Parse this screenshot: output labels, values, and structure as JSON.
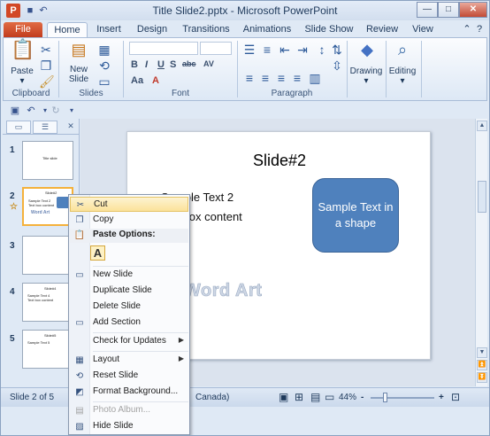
{
  "window": {
    "title": "Title Slide2.pptx - Microsoft PowerPoint",
    "app_icon_letter": "P",
    "controls": [
      "minimize-icon",
      "maximize-icon",
      "close-icon"
    ]
  },
  "ribbon": {
    "tabs": [
      "File",
      "Home",
      "Insert",
      "Design",
      "Transitions",
      "Animations",
      "Slide Show",
      "Review",
      "View"
    ],
    "active_tab": "Home",
    "groups": {
      "clipboard": {
        "label": "Clipboard",
        "paste_label": "Paste"
      },
      "slides": {
        "label": "Slides",
        "new_slide_label": "New Slide"
      },
      "font": {
        "label": "Font",
        "glyphs": [
          "B",
          "I",
          "U",
          "S",
          "abc",
          "AV",
          "Aa",
          "A"
        ]
      },
      "paragraph": {
        "label": "Paragraph"
      },
      "drawing": {
        "label": "Drawing"
      },
      "editing": {
        "label": "Editing"
      }
    }
  },
  "slide_pane": {
    "thumbnails": [
      {
        "num": "1",
        "title": "Title slide"
      },
      {
        "num": "2",
        "title": "Slide#2",
        "line1": "Sample Text 2",
        "line2": "Text box content",
        "wordart": "Word Art",
        "selected": true
      },
      {
        "num": "3"
      },
      {
        "num": "4",
        "title": "Slide#4",
        "line1": "Sample Text 4",
        "line2": "Text box content"
      },
      {
        "num": "5",
        "title": "Slide#5",
        "line1": "Sample Text 5"
      }
    ]
  },
  "slide": {
    "title": "Slide#2",
    "text_line1": "Sample Text 2",
    "text_line2": "text box content",
    "shape_text": "Sample Text in a shape",
    "wordart": "Word Art",
    "shape_color": "#4f81bd"
  },
  "context_menu": {
    "items": [
      {
        "label": "Cut",
        "icon": "scissors-icon",
        "highlighted": true
      },
      {
        "label": "Copy",
        "icon": "copy-icon"
      },
      {
        "label": "Paste Options:",
        "icon": "paste-icon",
        "header": true
      },
      {
        "label": "A",
        "icon": "keep-text-only-icon"
      },
      {
        "label": "New Slide",
        "icon": "new-slide-icon"
      },
      {
        "label": "Duplicate Slide",
        "icon": ""
      },
      {
        "label": "Delete Slide",
        "icon": ""
      },
      {
        "label": "Add Section",
        "icon": "section-icon"
      },
      {
        "label": "Check for Updates",
        "icon": "",
        "submenu": true
      },
      {
        "label": "Layout",
        "icon": "layout-icon",
        "submenu": true
      },
      {
        "label": "Reset Slide",
        "icon": "reset-slide-icon"
      },
      {
        "label": "Format Background...",
        "icon": "format-background-icon"
      },
      {
        "label": "Photo Album...",
        "icon": "photo-album-icon",
        "disabled": true
      },
      {
        "label": "Hide Slide",
        "icon": "hide-slide-icon"
      }
    ]
  },
  "statusbar": {
    "slide_info": "Slide 2 of 5",
    "language": "Canada)",
    "zoom": "44%",
    "zoom_out": "-",
    "zoom_in": "+"
  }
}
